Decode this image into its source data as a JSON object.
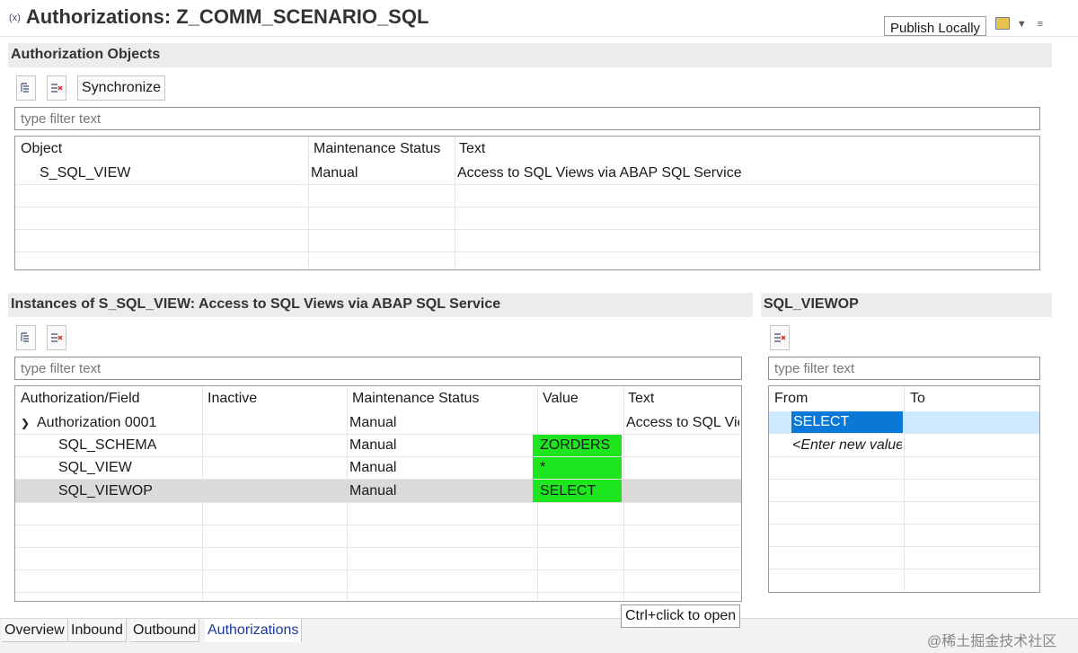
{
  "editor": {
    "title_icon": "(x)",
    "title": "Authorizations: Z_COMM_SCENARIO_SQL",
    "publish_label": "Publish Locally"
  },
  "auth_objects": {
    "header": "Authorization Objects",
    "sync_label": "Synchronize",
    "filter_placeholder": "type filter text",
    "columns": [
      "Object",
      "Maintenance Status",
      "Text"
    ],
    "rows": [
      {
        "object": "S_SQL_VIEW",
        "status": "Manual",
        "text": "Access to SQL Views via ABAP SQL Service"
      }
    ]
  },
  "instances": {
    "header": "Instances of S_SQL_VIEW: Access to SQL Views via ABAP SQL Service",
    "filter_placeholder": "type filter text",
    "columns": [
      "Authorization/Field",
      "Inactive",
      "Maintenance Status",
      "Value",
      "Text"
    ],
    "rows": [
      {
        "name": "Authorization 0001",
        "inactive": "",
        "status": "Manual",
        "value": "",
        "text": "Access to SQL Vie"
      },
      {
        "name": "SQL_SCHEMA",
        "inactive": "",
        "status": "Manual",
        "value": "ZORDERS",
        "text": ""
      },
      {
        "name": "SQL_VIEW",
        "inactive": "",
        "status": "Manual",
        "value": "*",
        "text": ""
      },
      {
        "name": "SQL_VIEWOP",
        "inactive": "",
        "status": "Manual",
        "value": "SELECT",
        "text": ""
      }
    ]
  },
  "field_values": {
    "header": "SQL_VIEWOP",
    "filter_placeholder": "type filter text",
    "columns": [
      "From",
      "To"
    ],
    "rows": [
      {
        "from": "SELECT",
        "to": ""
      }
    ],
    "new_value_placeholder": "<Enter new value"
  },
  "tooltip": "Ctrl+click to open",
  "tabs": [
    {
      "label": "Overview"
    },
    {
      "label": "Inbound"
    },
    {
      "label": "Outbound"
    },
    {
      "label": "Authorizations"
    }
  ],
  "watermark": "@稀土掘金技术社区",
  "icons": {
    "expand_all": "expand-all-icon",
    "remove": "remove-icon",
    "publish_menu": "dropdown-icon"
  },
  "colors": {
    "highlight_green": "#1ee61e",
    "selection_blue": "#0a78d7",
    "active_tab_text": "#1a3b9c"
  }
}
